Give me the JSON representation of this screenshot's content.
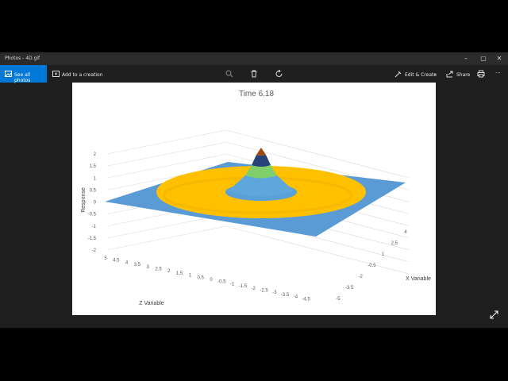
{
  "window": {
    "title": "Photos - 4D.gif",
    "minimize": "–",
    "maximize": "▢",
    "close": "✕"
  },
  "toolbar": {
    "see_all": "See all photos",
    "add_creation": "Add to a creation",
    "edit_create": "Edit & Create",
    "share": "Share",
    "more": "···"
  },
  "chart_data": {
    "type": "surface",
    "title": "Time 6.18",
    "ylabel": "Response",
    "zlabel": "Z Variable",
    "xlabel": "X Variable",
    "y_ticks": [
      "2",
      "1.5",
      "1",
      "0.5",
      "0",
      "-0.5",
      "-1",
      "-1.5",
      "-2"
    ],
    "z_ticks": [
      "5",
      "4.5",
      "4",
      "3.5",
      "3",
      "2.5",
      "2",
      "1.5",
      "1",
      "0.5",
      "0",
      "-0.5",
      "-1",
      "-1.5",
      "-2",
      "-2.5",
      "-3",
      "-3.5",
      "-4",
      "-4.5"
    ],
    "x_ticks": [
      "4",
      "2.5",
      "1",
      "-0.5",
      "-2",
      "-3.5",
      "-5"
    ],
    "ylim": [
      -2,
      2
    ],
    "colors": [
      "#5b9bd5",
      "#ffc000",
      "#a5a5a5",
      "#70ad47",
      "#264478",
      "#9e480e"
    ]
  }
}
